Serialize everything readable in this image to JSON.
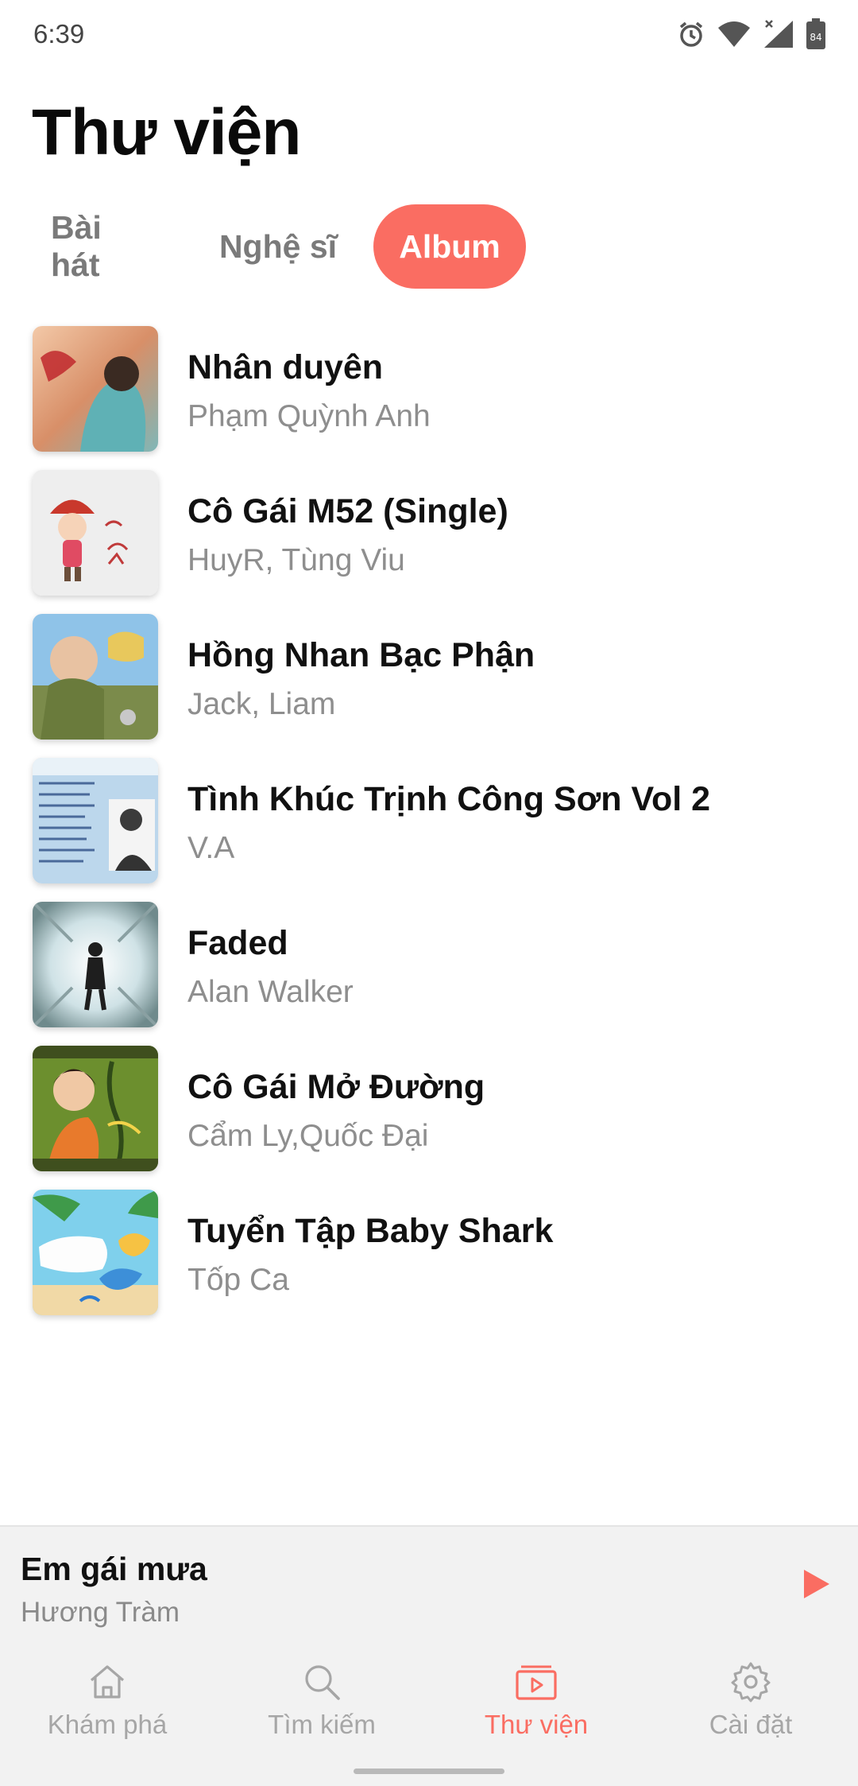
{
  "status_bar": {
    "time": "6:39",
    "battery_level": "84",
    "icons": [
      "alarm-icon",
      "wifi-icon",
      "signal-icon",
      "battery-icon"
    ]
  },
  "page": {
    "title": "Thư viện"
  },
  "tabs": [
    {
      "label": "Bài hát",
      "active": false
    },
    {
      "label": "Nghệ sĩ",
      "active": false
    },
    {
      "label": "Album",
      "active": true
    }
  ],
  "albums": [
    {
      "title": "Nhân duyên",
      "artist": "Phạm Quỳnh Anh"
    },
    {
      "title": "Cô Gái M52 (Single)",
      "artist": "HuyR, Tùng Viu"
    },
    {
      "title": "Hồng Nhan Bạc Phận",
      "artist": "Jack, Liam"
    },
    {
      "title": "Tình Khúc Trịnh Công Sơn Vol 2",
      "artist": "V.A"
    },
    {
      "title": "Faded",
      "artist": "Alan Walker"
    },
    {
      "title": "Cô Gái Mở Đường",
      "artist": "Cẩm Ly,Quốc Đại"
    },
    {
      "title": "Tuyển Tập Baby Shark",
      "artist": "Tốp Ca"
    }
  ],
  "now_playing": {
    "title": "Em gái mưa",
    "artist": "Hương Tràm"
  },
  "bottom_nav": [
    {
      "label": "Khám phá",
      "icon": "home-icon",
      "active": false
    },
    {
      "label": "Tìm kiếm",
      "icon": "search-icon",
      "active": false
    },
    {
      "label": "Thư viện",
      "icon": "library-icon",
      "active": true
    },
    {
      "label": "Cài đặt",
      "icon": "gear-icon",
      "active": false
    }
  ],
  "colors": {
    "accent": "#fa6d62",
    "secondary_text": "#8e8e8e",
    "nav_inactive": "#a6a6a6"
  }
}
